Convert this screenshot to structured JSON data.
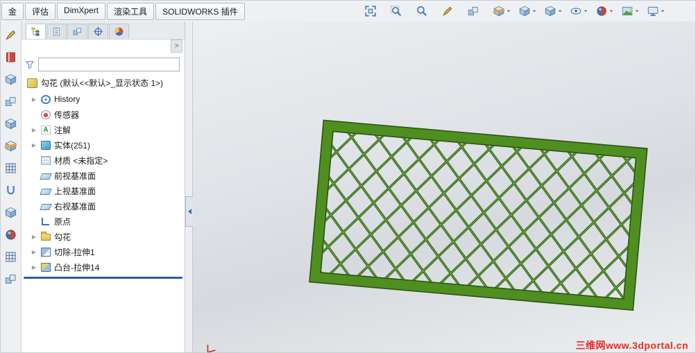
{
  "icons": {
    "expand_arrow": "▶",
    "overflow_chevron": ">"
  },
  "top_tabs": [
    {
      "label": "金",
      "name": "tab-sheet-metal"
    },
    {
      "label": "评估",
      "name": "tab-evaluate"
    },
    {
      "label": "DimXpert",
      "name": "tab-dimxpert"
    },
    {
      "label": "渲染工具",
      "name": "tab-render-tools"
    },
    {
      "label": "SOLIDWORKS 插件",
      "name": "tab-solidworks-addins"
    }
  ],
  "headsup": [
    {
      "name": "zoom-to-fit-button",
      "sym": "fit",
      "caret": false
    },
    {
      "name": "zoom-to-area-button",
      "sym": "magnifier-box",
      "caret": false
    },
    {
      "name": "zoom-in-out-button",
      "sym": "magnifier",
      "caret": false
    },
    {
      "name": "rotate-view-button",
      "sym": "pencil",
      "caret": false
    },
    {
      "name": "pan-button",
      "sym": "cubes",
      "caret": false
    },
    {
      "name": "section-view-button",
      "sym": "section",
      "caret": true
    },
    {
      "name": "view-orientation-button",
      "sym": "cube",
      "caret": true
    },
    {
      "name": "display-style-button",
      "sym": "cube",
      "caret": true
    },
    {
      "name": "hide-show-items-button",
      "sym": "eye",
      "caret": true
    },
    {
      "name": "edit-appearance-button",
      "sym": "sphere",
      "caret": true
    },
    {
      "name": "apply-scene-button",
      "sym": "scene",
      "caret": true
    },
    {
      "name": "view-settings-button",
      "sym": "monitor",
      "caret": true
    }
  ],
  "left_toolbar": [
    {
      "name": "left-tool-1",
      "sym": "pencil"
    },
    {
      "name": "left-tool-2",
      "sym": "book"
    },
    {
      "name": "left-tool-3",
      "sym": "cube"
    },
    {
      "name": "left-tool-4",
      "sym": "cubes"
    },
    {
      "name": "left-tool-5",
      "sym": "cube"
    },
    {
      "name": "left-tool-6",
      "sym": "section"
    },
    {
      "name": "left-tool-7",
      "sym": "grid"
    },
    {
      "name": "left-tool-8",
      "sym": "pin"
    },
    {
      "name": "left-tool-9",
      "sym": "cube"
    },
    {
      "name": "left-tool-10",
      "sym": "sphere"
    },
    {
      "name": "left-tool-11",
      "sym": "grid"
    },
    {
      "name": "left-tool-12",
      "sym": "cubes"
    }
  ],
  "panel": {
    "tabs": [
      {
        "name": "featuremanager-tab",
        "sym": "tree",
        "cls": "active"
      },
      {
        "name": "propertymanager-tab",
        "sym": "clip",
        "cls": ""
      },
      {
        "name": "configurationmanager-tab",
        "sym": "cubes",
        "cls": ""
      },
      {
        "name": "dimxpertmanager-tab",
        "sym": "target",
        "cls": ""
      },
      {
        "name": "displaymanager-tab",
        "sym": "wheel",
        "cls": ""
      }
    ],
    "filter_placeholder": "",
    "filter_value": "",
    "root_label": "勾花 (默认<<默认>_显示状态 1>)",
    "tree": [
      {
        "label": "History",
        "icon": "history",
        "arrow": true
      },
      {
        "label": "传感器",
        "icon": "sensor",
        "arrow": false
      },
      {
        "label": "注解",
        "icon": "annotations",
        "arrow": true
      },
      {
        "label": "实体(251)",
        "icon": "solids",
        "arrow": true
      },
      {
        "label": "材质 <未指定>",
        "icon": "material",
        "arrow": false
      },
      {
        "label": "前视基准面",
        "icon": "plane",
        "arrow": false
      },
      {
        "label": "上视基准面",
        "icon": "plane",
        "arrow": false
      },
      {
        "label": "右视基准面",
        "icon": "plane",
        "arrow": false
      },
      {
        "label": "原点",
        "icon": "origin",
        "arrow": false
      },
      {
        "label": "勾花",
        "icon": "folder",
        "arrow": true
      },
      {
        "label": "切除-拉伸1",
        "icon": "cut",
        "arrow": true
      },
      {
        "label": "凸台-拉伸14",
        "icon": "boss",
        "arrow": true
      }
    ]
  },
  "model": {
    "frame_color": "#4f8f20",
    "frame_edge_color": "#2c5212",
    "mesh_color": "#2f6016",
    "mesh_highlight": "#79b349"
  },
  "viewport": {
    "watermark": "三维网www.3dportal.cn"
  }
}
